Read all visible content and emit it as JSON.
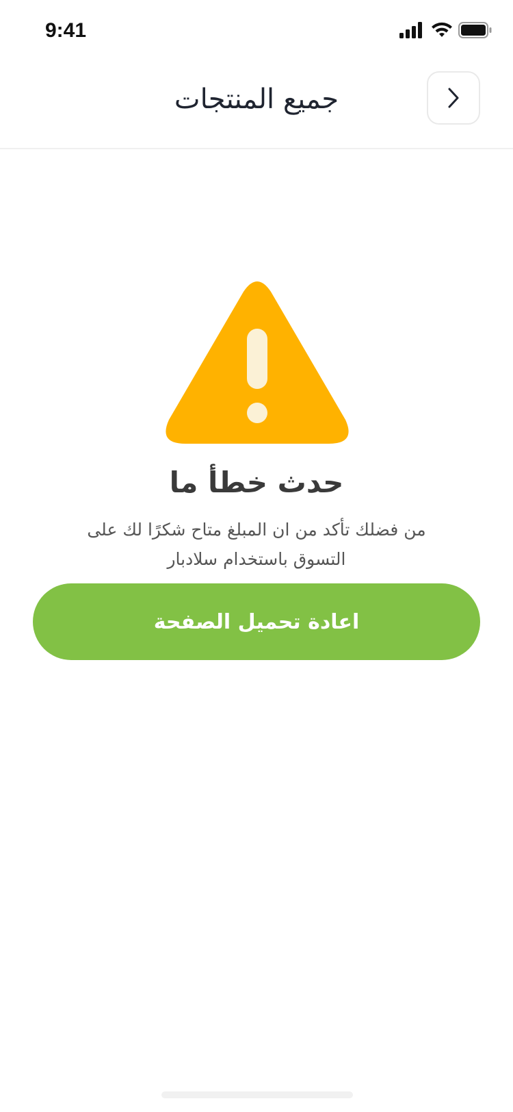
{
  "status_bar": {
    "time": "9:41",
    "icons": [
      "signal-icon",
      "wifi-icon",
      "battery-icon"
    ]
  },
  "header": {
    "title": "جميع المنتجات",
    "back_icon": "chevron-right-icon"
  },
  "error": {
    "icon": "warning-icon",
    "icon_color": "#FFB200",
    "title": "حدث خطأ ما",
    "message": "من فضلك تأكد من ان المبلغ متاح شكرًا لك على التسوق باستخدام سلادبار"
  },
  "reload_button": {
    "label": "اعادة تحميل الصفحة",
    "color": "#82C145"
  }
}
